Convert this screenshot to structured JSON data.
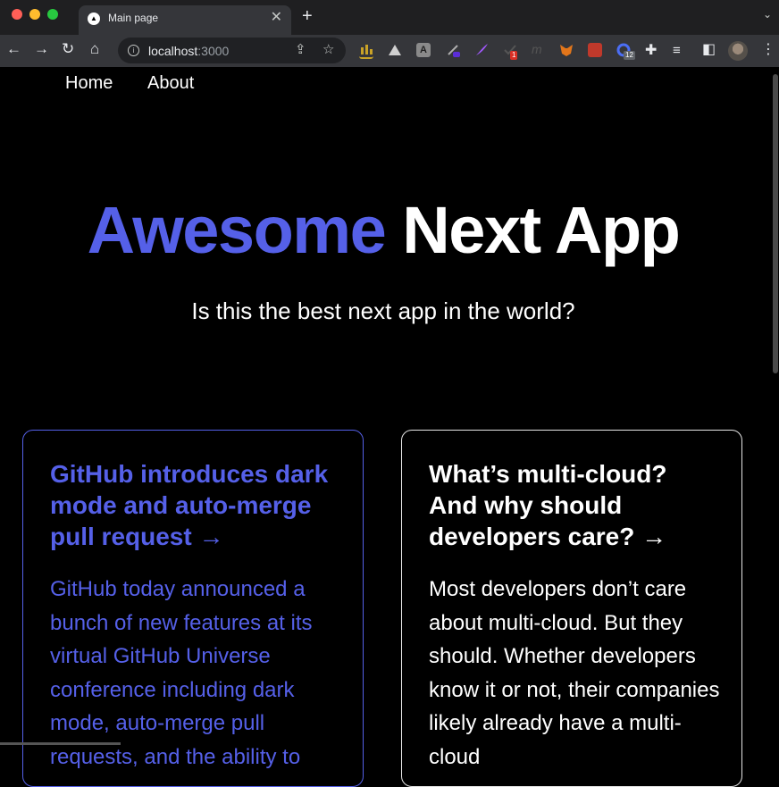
{
  "browser": {
    "tab_title": "Main page",
    "tab_close": "✕",
    "new_tab": "+",
    "tab_menu": "⌄",
    "url_host": "localhost",
    "url_port": ":3000",
    "info_glyph": "i",
    "ext_badge_red": "1",
    "ext_badge_blue": "12",
    "ext_m_glyph": "m",
    "ext_a_glyph": "A"
  },
  "nav": {
    "home": "Home",
    "about": "About"
  },
  "hero": {
    "title_accent": "Awesome",
    "title_rest": " Next App",
    "subtitle": "Is this the best next app in the world?"
  },
  "cards": [
    {
      "title": "GitHub introduces dark mode and auto-merge pull request →",
      "body": "GitHub today announced a bunch of new features at its virtual GitHub Universe conference including dark mode, auto-merge pull requests, and the ability to"
    },
    {
      "title": "What’s multi-cloud? And why should developers care? →",
      "body": "Most developers don’t care about multi-cloud. But they should. Whether developers know it or not, their companies likely already have a multi-cloud"
    }
  ],
  "colors": {
    "accent": "#5560e8",
    "background": "#000000",
    "text": "#ffffff"
  }
}
